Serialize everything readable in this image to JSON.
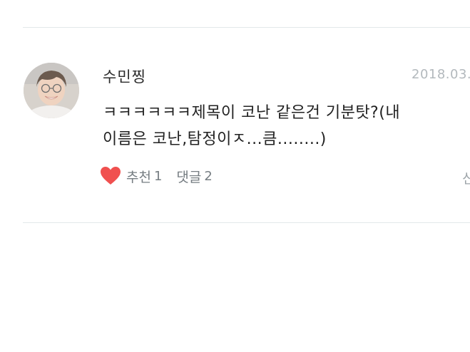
{
  "comment_item": {
    "username": "수민찡",
    "timestamp": "2018.03.",
    "text_line1": "ㅋㅋㅋㅋㅋㅋ제목이 코난 같은건 기분탓?(내",
    "text_line2": "이름은 코난,탐정이ㅈ...큼........)",
    "like_label": "추천",
    "like_count": "1",
    "reply_label": "댓글",
    "reply_count": "2",
    "trailing_text": "신"
  },
  "colors": {
    "heart": "#f0504f",
    "divider": "#e3e8ea",
    "timestamp": "#b3b9bd"
  },
  "icons": {
    "like": "heart-icon",
    "avatar": "user-avatar"
  }
}
